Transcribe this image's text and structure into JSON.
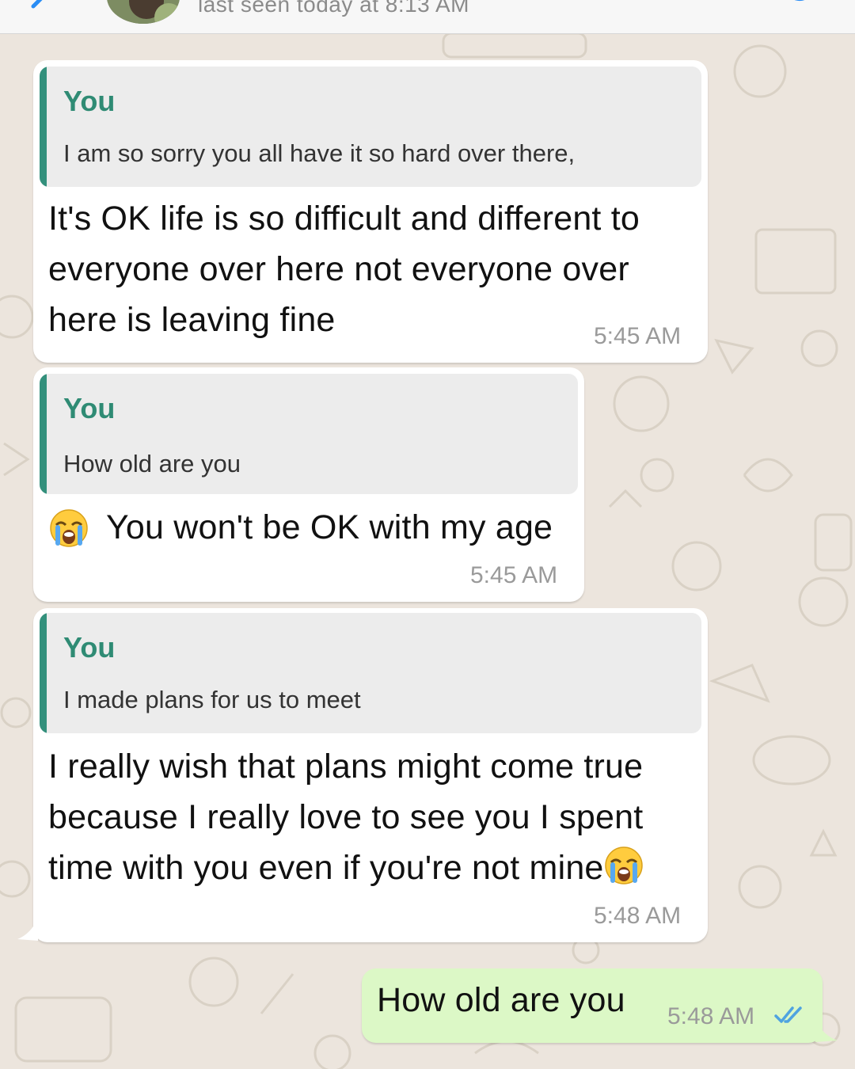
{
  "header": {
    "status": "last seen today at 8:13 AM"
  },
  "messages": [
    {
      "direction": "incoming",
      "quote": {
        "author": "You",
        "text": "I am so sorry you all have it so hard over there,"
      },
      "lines": [
        "It's OK life is so difficult and different to",
        "everyone over here not everyone over",
        "here is leaving fine"
      ],
      "time": "5:45 AM"
    },
    {
      "direction": "incoming",
      "quote": {
        "author": "You",
        "text": "How old are you"
      },
      "text": "You won't be OK with my age",
      "leading_emoji": "crying-face-icon",
      "time": "5:45 AM"
    },
    {
      "direction": "incoming",
      "quote": {
        "author": "You",
        "text": "I made plans for us to meet"
      },
      "lines": [
        "I really wish that plans might come true",
        "because I really love to see you I spent",
        "time with you even if you're not mine"
      ],
      "trailing_emoji": "crying-face-icon",
      "time": "5:48 AM"
    },
    {
      "direction": "outgoing",
      "text": "How old are you",
      "time": "5:48 AM",
      "status_icon": "double-check-icon"
    }
  ],
  "colors": {
    "background": "#ece5dd",
    "incoming_bubble": "#ffffff",
    "outgoing_bubble": "#dcf8c6",
    "quote_bar": "#33907c",
    "quote_author": "#2f8b74",
    "read_ticks": "#4fa3e0"
  }
}
